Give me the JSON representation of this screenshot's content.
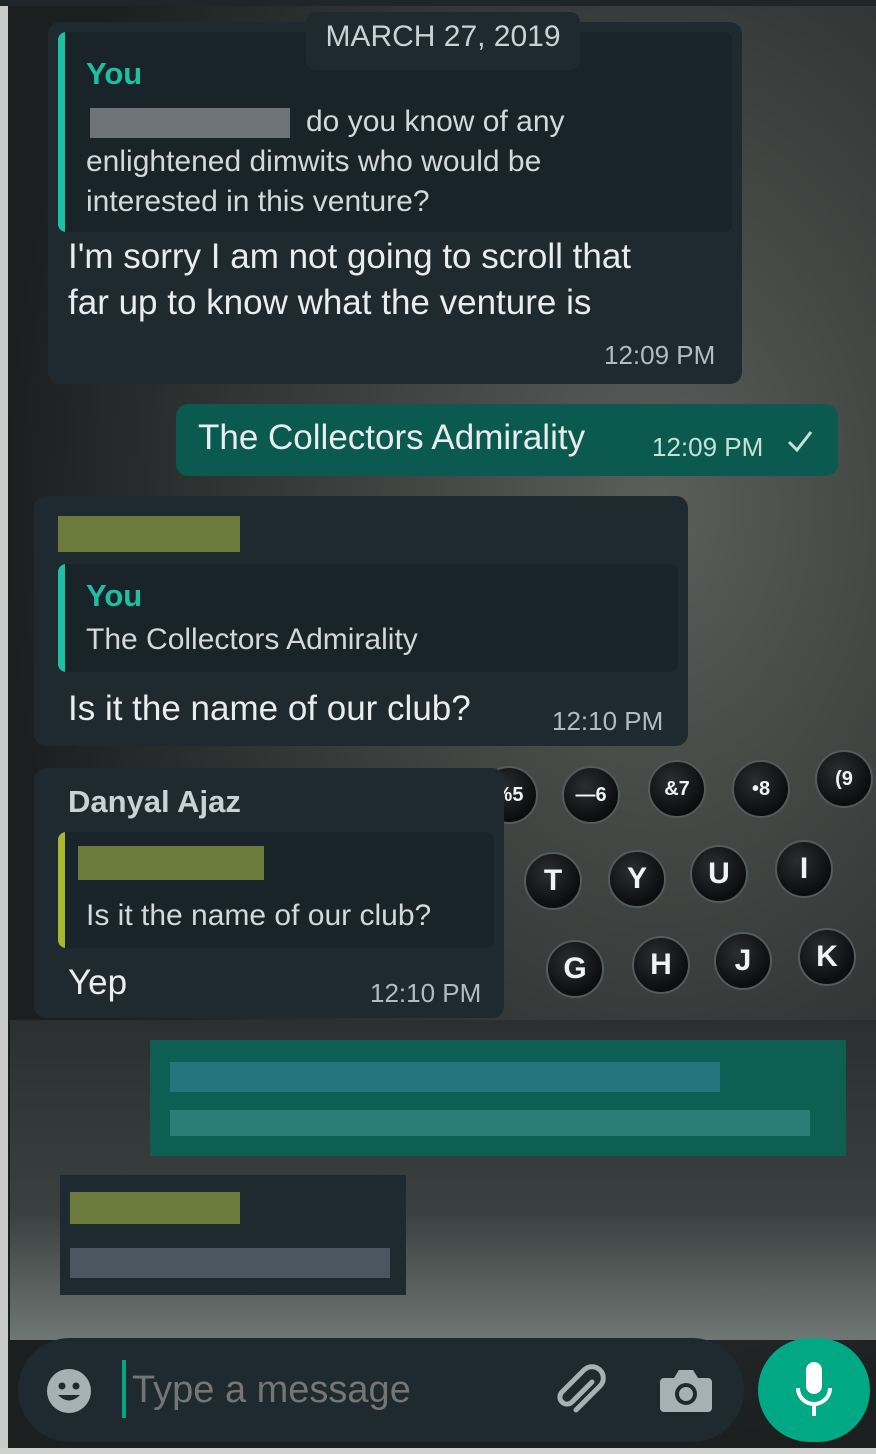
{
  "date_separator": "MARCH 27, 2019",
  "messages": [
    {
      "direction": "incoming",
      "quote": {
        "author": "You",
        "text_line1": "do you know of any",
        "text_line2": "enlightened dimwits who would be",
        "text_line3": "interested in this venture?"
      },
      "text_line1": "I'm sorry I am not going to scroll that",
      "text_line2": "far up to know what the venture is",
      "time": "12:09 PM"
    },
    {
      "direction": "outgoing",
      "text": "The Collectors Admirality",
      "time": "12:09 PM",
      "status_icon": "single-check"
    },
    {
      "direction": "incoming",
      "quote": {
        "author": "You",
        "text": "The Collectors Admirality"
      },
      "text": "Is it the name of our club?",
      "time": "12:10 PM"
    },
    {
      "direction": "incoming",
      "sender": "Danyal Ajaz",
      "quote": {
        "text": "Is it the name of our club?"
      },
      "text": "Yep",
      "time": "12:10 PM"
    }
  ],
  "composer": {
    "placeholder": "Type a message",
    "emoji_icon": "emoji-icon",
    "attach_icon": "paperclip-icon",
    "camera_icon": "camera-icon",
    "mic_icon": "mic-icon"
  },
  "wallpaper_keys": {
    "row1": [
      "%5",
      "—6",
      "&7",
      "•8",
      "(9"
    ],
    "row2": [
      "T",
      "Y",
      "U",
      "I"
    ],
    "row3": [
      "G",
      "H",
      "J",
      "K"
    ]
  },
  "colors": {
    "accent": "#00a884",
    "incoming_bubble": "#1e2a30",
    "outgoing_bubble": "#0a5a4f",
    "quote_author": "#1fbfa1",
    "quote_bar_you": "#1fbfa1",
    "quote_bar_other": "#a5b830"
  }
}
